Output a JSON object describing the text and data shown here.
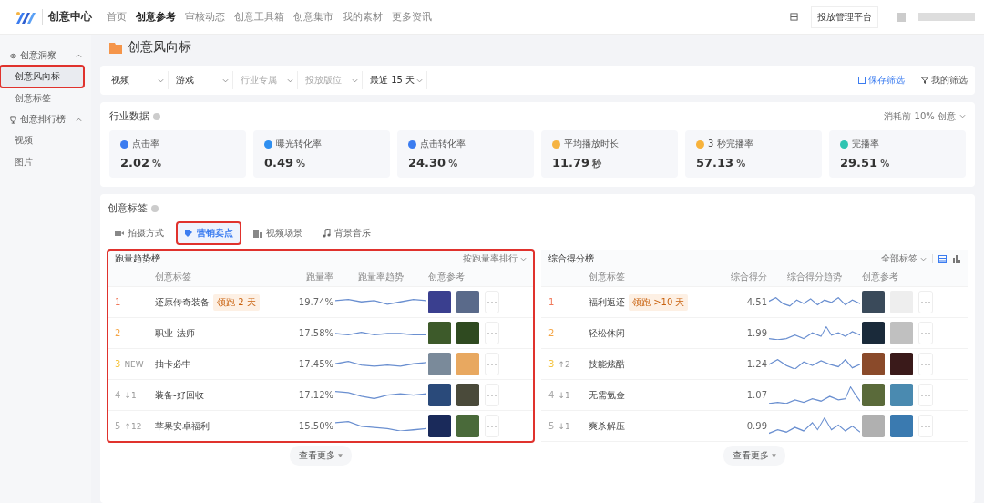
{
  "topbar": {
    "brand": "创意中心",
    "nav": [
      {
        "label": "首页",
        "selected": false
      },
      {
        "label": "创意参考",
        "selected": true
      },
      {
        "label": "审核动态",
        "selected": false
      },
      {
        "label": "创意工具箱",
        "selected": false
      },
      {
        "label": "创意集市",
        "selected": false
      },
      {
        "label": "我的素材",
        "selected": false
      },
      {
        "label": "更多资讯",
        "selected": false
      }
    ],
    "platform_button": "投放管理平台"
  },
  "sidebar": {
    "groups": [
      {
        "label": "创意洞察",
        "expanded": true,
        "children": [
          {
            "label": "创意风向标",
            "selected": true,
            "annotated": true
          },
          {
            "label": "创意标签",
            "selected": false,
            "annotated": false
          }
        ]
      },
      {
        "label": "创意排行榜",
        "expanded": true,
        "children": [
          {
            "label": "视频",
            "selected": false,
            "annotated": false
          },
          {
            "label": "图片",
            "selected": false,
            "annotated": false
          }
        ]
      }
    ]
  },
  "page_title": "创意风向标",
  "filters": {
    "selects": [
      {
        "value": "视频"
      },
      {
        "value": "游戏"
      },
      {
        "placeholder": "行业专属"
      },
      {
        "placeholder": "投放版位"
      },
      {
        "value": "最近 15 天"
      }
    ],
    "save": "保存筛选",
    "mine": "我的筛选"
  },
  "industry": {
    "title": "行业数据",
    "scope": "消耗前 10% 创意",
    "metrics": [
      {
        "label": "点击率",
        "value": "2.02",
        "unit": "%",
        "color": "#3b7cf0"
      },
      {
        "label": "曝光转化率",
        "value": "0.49",
        "unit": "%",
        "color": "#2f8ff0"
      },
      {
        "label": "点击转化率",
        "value": "24.30",
        "unit": "%",
        "color": "#3b7cf0"
      },
      {
        "label": "平均播放时长",
        "value": "11.79",
        "unit": "秒",
        "color": "#f5b342"
      },
      {
        "label": "3 秒完播率",
        "value": "57.13",
        "unit": "%",
        "color": "#f7b23b"
      },
      {
        "label": "完播率",
        "value": "29.51",
        "unit": "%",
        "color": "#2fc4b2"
      }
    ]
  },
  "tags": {
    "title": "创意标签",
    "tabs": [
      {
        "label": "拍摄方式",
        "selected": false,
        "annotated": false
      },
      {
        "label": "营销卖点",
        "selected": true,
        "annotated": true
      },
      {
        "label": "视频场景",
        "selected": false,
        "annotated": false
      },
      {
        "label": "背景音乐",
        "selected": false,
        "annotated": false
      }
    ],
    "boards": [
      {
        "title": "跑量趋势榜",
        "control": "按跑量率排行",
        "annotated": true,
        "columns": [
          "创意标签",
          "跑量率",
          "跑量率趋势",
          "创意参考"
        ],
        "rows": [
          {
            "rank": "1",
            "change": "-",
            "label": "还原传奇装备",
            "badge": "领跑 2 天",
            "value": "19.74%"
          },
          {
            "rank": "2",
            "change": "-",
            "label": "职业-法师",
            "value": "17.58%"
          },
          {
            "rank": "3",
            "change": "NEW",
            "label": "抽卡必中",
            "value": "17.45%"
          },
          {
            "rank": "4",
            "change": "↓1",
            "label": "装备-好回收",
            "value": "17.12%"
          },
          {
            "rank": "5",
            "change": "↑12",
            "label": "苹果安卓福利",
            "value": "15.50%"
          }
        ],
        "more": "查看更多"
      },
      {
        "title": "综合得分榜",
        "control": "全部标签",
        "annotated": false,
        "view_toggle": true,
        "columns": [
          "创意标签",
          "综合得分",
          "综合得分趋势",
          "创意参考"
        ],
        "rows": [
          {
            "rank": "1",
            "change": "-",
            "label": "福利返还",
            "badge": "领跑 >10 天",
            "value": "4.51"
          },
          {
            "rank": "2",
            "change": "-",
            "label": "轻松休闲",
            "value": "1.99"
          },
          {
            "rank": "3",
            "change": "↑2",
            "label": "技能炫酷",
            "value": "1.24"
          },
          {
            "rank": "4",
            "change": "↓1",
            "label": "无需氪金",
            "value": "1.07"
          },
          {
            "rank": "5",
            "change": "↓1",
            "label": "爽杀解压",
            "value": "0.99"
          }
        ],
        "more": "查看更多"
      }
    ]
  }
}
